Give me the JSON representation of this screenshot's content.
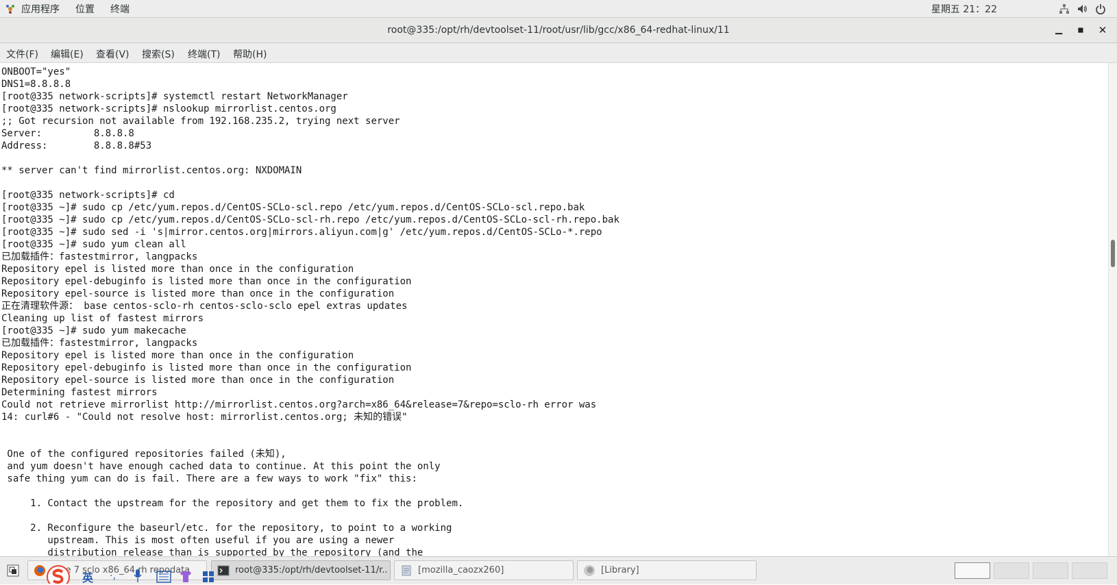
{
  "topbar": {
    "menu": [
      "应用程序",
      "位置",
      "终端"
    ],
    "clock": "星期五 21：22",
    "tray_icons": [
      "network-icon",
      "volume-icon",
      "power-icon"
    ]
  },
  "window": {
    "title": "root@335:/opt/rh/devtoolset-11/root/usr/lib/gcc/x86_64-redhat-linux/11",
    "controls": [
      "minimize",
      "maximize",
      "close"
    ]
  },
  "menubar": [
    "文件(F)",
    "编辑(E)",
    "查看(V)",
    "搜索(S)",
    "终端(T)",
    "帮助(H)"
  ],
  "terminal": {
    "lines": [
      "ONBOOT=\"yes\"",
      "DNS1=8.8.8.8",
      "[root@335 network-scripts]# systemctl restart NetworkManager",
      "[root@335 network-scripts]# nslookup mirrorlist.centos.org",
      ";; Got recursion not available from 192.168.235.2, trying next server",
      "Server:         8.8.8.8",
      "Address:        8.8.8.8#53",
      "",
      "** server can't find mirrorlist.centos.org: NXDOMAIN",
      "",
      "[root@335 network-scripts]# cd",
      "[root@335 ~]# sudo cp /etc/yum.repos.d/CentOS-SCLo-scl.repo /etc/yum.repos.d/CentOS-SCLo-scl.repo.bak",
      "[root@335 ~]# sudo cp /etc/yum.repos.d/CentOS-SCLo-scl-rh.repo /etc/yum.repos.d/CentOS-SCLo-scl-rh.repo.bak",
      "[root@335 ~]# sudo sed -i 's|mirror.centos.org|mirrors.aliyun.com|g' /etc/yum.repos.d/CentOS-SCLo-*.repo",
      "[root@335 ~]# sudo yum clean all",
      "已加载插件：fastestmirror, langpacks",
      "Repository epel is listed more than once in the configuration",
      "Repository epel-debuginfo is listed more than once in the configuration",
      "Repository epel-source is listed more than once in the configuration",
      "正在清理软件源： base centos-sclo-rh centos-sclo-sclo epel extras updates",
      "Cleaning up list of fastest mirrors",
      "[root@335 ~]# sudo yum makecache",
      "已加载插件：fastestmirror, langpacks",
      "Repository epel is listed more than once in the configuration",
      "Repository epel-debuginfo is listed more than once in the configuration",
      "Repository epel-source is listed more than once in the configuration",
      "Determining fastest mirrors",
      "Could not retrieve mirrorlist http://mirrorlist.centos.org?arch=x86_64&release=7&repo=sclo-rh error was",
      "14: curl#6 - \"Could not resolve host: mirrorlist.centos.org; 未知的错误\"",
      "",
      "",
      " One of the configured repositories failed (未知),",
      " and yum doesn't have enough cached data to continue. At this point the only",
      " safe thing yum can do is fail. There are a few ways to work \"fix\" this:",
      "",
      "     1. Contact the upstream for the repository and get them to fix the problem.",
      "",
      "     2. Reconfigure the baseurl/etc. for the repository, to point to a working",
      "        upstream. This is most often useful if you are using a newer",
      "        distribution release than is supported by the repository (and the"
    ]
  },
  "scrollbar": {
    "position_fraction": 0.38
  },
  "taskbar": {
    "tasks": [
      {
        "label": "...ne 7 sclo x86_64 rh repodata",
        "icon": "firefox-icon",
        "active": false
      },
      {
        "label": "root@335:/opt/rh/devtoolset-11/r...",
        "icon": "terminal-icon",
        "active": true
      },
      {
        "label": "[mozilla_caozx260]",
        "icon": "file-manager-icon",
        "active": false
      },
      {
        "label": "[Library]",
        "icon": "firefox-icon",
        "active": false
      }
    ],
    "workspaces": [
      true,
      false,
      false,
      false
    ],
    "ime_label": "英"
  }
}
